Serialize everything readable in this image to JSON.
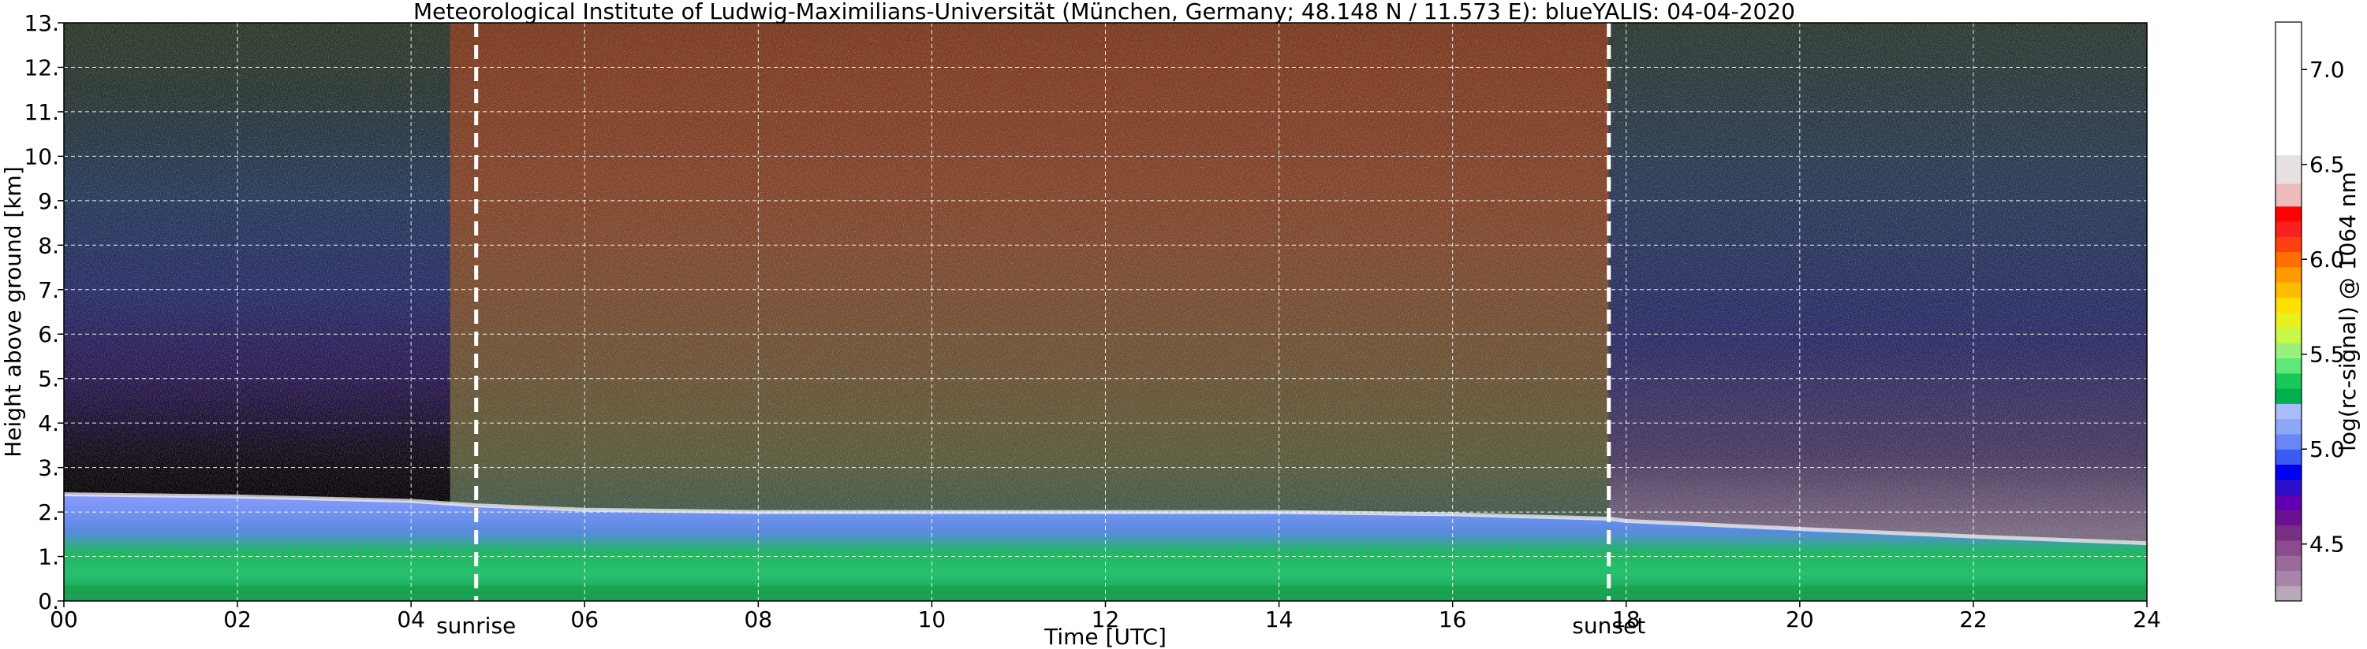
{
  "chart_data": {
    "type": "heatmap",
    "title": "Meteorological Institute of Ludwig-Maximilians-Universität (München, Germany; 48.148 N / 11.573 E):    blueYALIS: 04-04-2020",
    "xlabel": "Time [UTC]",
    "ylabel": "Height above ground [km]",
    "xlim": [
      0,
      24
    ],
    "ylim": [
      0,
      13
    ],
    "x_ticks": [
      0,
      2,
      4,
      6,
      8,
      10,
      12,
      14,
      16,
      18,
      20,
      22,
      24
    ],
    "x_tick_labels": [
      "00",
      "02",
      "04",
      "06",
      "08",
      "10",
      "12",
      "14",
      "16",
      "18",
      "20",
      "22",
      "24"
    ],
    "y_ticks": [
      0,
      1,
      2,
      3,
      4,
      5,
      6,
      7,
      8,
      9,
      10,
      11,
      12,
      13
    ],
    "y_tick_labels": [
      "0.",
      "1.",
      "2.",
      "3.",
      "4.",
      "5.",
      "6.",
      "7.",
      "8.",
      "9.",
      "10.",
      "11.",
      "12.",
      "13."
    ],
    "grid": true,
    "markers": [
      {
        "label": "sunrise",
        "x": 4.75
      },
      {
        "label": "sunset",
        "x": 17.8
      }
    ],
    "colorbar": {
      "label": "log(rc-signal) @ 1064 nm",
      "range": [
        4.2,
        7.25
      ],
      "tick_values": [
        4.5,
        5.0,
        5.5,
        6.0,
        6.5,
        7.0
      ],
      "tick_labels": [
        "4.5",
        "5.0",
        "5.5",
        "6.0",
        "6.5",
        "7.0"
      ],
      "bands": [
        {
          "from": 4.2,
          "to": 4.28,
          "color": "#b9a8b9"
        },
        {
          "from": 4.28,
          "to": 4.36,
          "color": "#a884a8"
        },
        {
          "from": 4.36,
          "to": 4.44,
          "color": "#9a6a9a"
        },
        {
          "from": 4.44,
          "to": 4.52,
          "color": "#8a4c8c"
        },
        {
          "from": 4.52,
          "to": 4.6,
          "color": "#7a2f84"
        },
        {
          "from": 4.6,
          "to": 4.68,
          "color": "#6a1090"
        },
        {
          "from": 4.68,
          "to": 4.76,
          "color": "#6000b0"
        },
        {
          "from": 4.76,
          "to": 4.84,
          "color": "#2a10c8"
        },
        {
          "from": 4.84,
          "to": 4.92,
          "color": "#0000f0"
        },
        {
          "from": 4.92,
          "to": 5.0,
          "color": "#3a5cf2"
        },
        {
          "from": 5.0,
          "to": 5.08,
          "color": "#6a86f4"
        },
        {
          "from": 5.08,
          "to": 5.16,
          "color": "#8ea6f6"
        },
        {
          "from": 5.16,
          "to": 5.24,
          "color": "#aabcf8"
        },
        {
          "from": 5.24,
          "to": 5.32,
          "color": "#00b050"
        },
        {
          "from": 5.32,
          "to": 5.4,
          "color": "#18c85a"
        },
        {
          "from": 5.4,
          "to": 5.48,
          "color": "#5ee87a"
        },
        {
          "from": 5.48,
          "to": 5.56,
          "color": "#9af07a"
        },
        {
          "from": 5.56,
          "to": 5.64,
          "color": "#c8f848"
        },
        {
          "from": 5.64,
          "to": 5.72,
          "color": "#e8f020"
        },
        {
          "from": 5.72,
          "to": 5.8,
          "color": "#ffe000"
        },
        {
          "from": 5.8,
          "to": 5.88,
          "color": "#ffbc00"
        },
        {
          "from": 5.88,
          "to": 5.96,
          "color": "#ff9a00"
        },
        {
          "from": 5.96,
          "to": 6.04,
          "color": "#ff7000"
        },
        {
          "from": 6.04,
          "to": 6.12,
          "color": "#ff4010"
        },
        {
          "from": 6.12,
          "to": 6.2,
          "color": "#f82020"
        },
        {
          "from": 6.2,
          "to": 6.28,
          "color": "#ff0000"
        },
        {
          "from": 6.28,
          "to": 6.4,
          "color": "#ecbcbc"
        },
        {
          "from": 6.4,
          "to": 6.55,
          "color": "#e8e0e0"
        },
        {
          "from": 6.55,
          "to": 7.25,
          "color": "#ffffff"
        }
      ]
    },
    "layers": {
      "boundary_layer_top_km": [
        [
          0,
          2.4
        ],
        [
          2,
          2.35
        ],
        [
          4,
          2.25
        ],
        [
          4.75,
          2.15
        ],
        [
          6,
          2.05
        ],
        [
          8,
          2.0
        ],
        [
          10,
          2.0
        ],
        [
          12,
          2.0
        ],
        [
          14,
          2.0
        ],
        [
          16,
          1.95
        ],
        [
          17.8,
          1.85
        ],
        [
          18,
          1.8
        ],
        [
          20,
          1.62
        ],
        [
          22,
          1.45
        ],
        [
          24,
          1.3
        ]
      ]
    }
  }
}
